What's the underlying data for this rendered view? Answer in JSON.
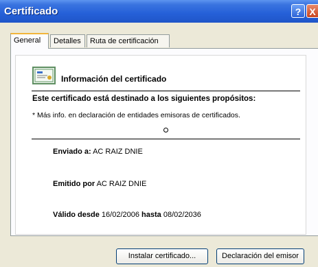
{
  "window": {
    "title": "Certificado",
    "help_glyph": "?",
    "close_glyph": "X"
  },
  "tabs": [
    {
      "label": "General",
      "active": true
    },
    {
      "label": "Detalles",
      "active": false
    },
    {
      "label": "Ruta de certificación",
      "active": false
    }
  ],
  "general": {
    "header": "Información del certificado",
    "purposes_heading": "Este certificado está destinado a los siguientes propósitos:",
    "purposes_note": "* Más info. en declaración de entidades emisoras de certificados.",
    "issued_to_label": "Enviado a:",
    "issued_to_value": "AC RAIZ DNIE",
    "issued_by_label": "Emitido por",
    "issued_by_value": "AC RAIZ DNIE",
    "valid_from_label": "Válido desde",
    "valid_from_value": "16/02/2006",
    "valid_to_label": "hasta",
    "valid_to_value": "08/02/2036"
  },
  "buttons": {
    "install": "Instalar certificado...",
    "statement": "Declaración del emisor"
  },
  "colors": {
    "titlebar": "#2560d8",
    "active_tab_accent": "#f2b53a"
  },
  "icons": [
    "certificate-icon",
    "help-icon",
    "close-icon"
  ]
}
